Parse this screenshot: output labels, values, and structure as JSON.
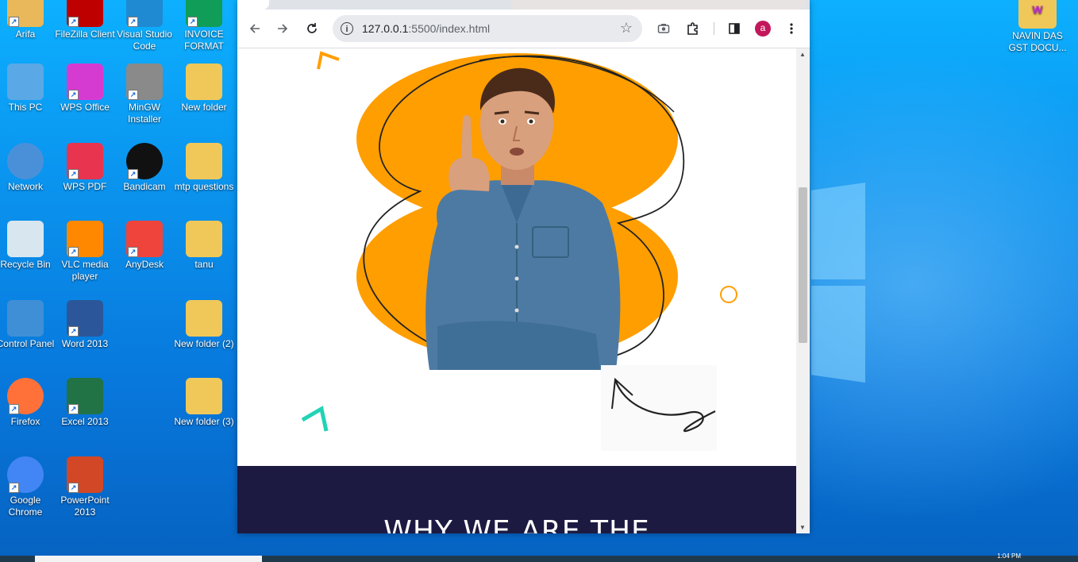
{
  "desktop": {
    "icons_col1": [
      {
        "label": "Arifa",
        "icon": "user-folder-icon",
        "color": "#e8b85a"
      },
      {
        "label": "This PC",
        "icon": "computer-icon",
        "color": "#5aa8e6"
      },
      {
        "label": "Network",
        "icon": "network-icon",
        "color": "#4a90d9"
      },
      {
        "label": "Recycle Bin",
        "icon": "recycle-bin-icon",
        "color": "#d8e6f0"
      },
      {
        "label": "Control Panel",
        "icon": "control-panel-icon",
        "color": "#3f8fd6"
      },
      {
        "label": "Firefox",
        "icon": "firefox-icon",
        "color": "#ff7139"
      },
      {
        "label": "Google Chrome",
        "icon": "chrome-icon",
        "color": "#4285f4"
      }
    ],
    "icons_col2": [
      {
        "label": "FileZilla Client",
        "icon": "filezilla-icon",
        "color": "#bf0000"
      },
      {
        "label": "WPS Office",
        "icon": "wps-office-icon",
        "color": "#d63bd1"
      },
      {
        "label": "WPS PDF",
        "icon": "wps-pdf-icon",
        "color": "#e8344e"
      },
      {
        "label": "VLC media player",
        "icon": "vlc-icon",
        "color": "#ff8800"
      },
      {
        "label": "Word 2013",
        "icon": "word-icon",
        "color": "#2b579a"
      },
      {
        "label": "Excel 2013",
        "icon": "excel-icon",
        "color": "#217346"
      },
      {
        "label": "PowerPoint 2013",
        "icon": "powerpoint-icon",
        "color": "#d24726"
      }
    ],
    "icons_col3": [
      {
        "label": "Visual Studio Code",
        "icon": "vscode-icon",
        "color": "#1f8ad2"
      },
      {
        "label": "MinGW Installer",
        "icon": "mingw-installer-icon",
        "color": "#8a8a8a"
      },
      {
        "label": "Bandicam",
        "icon": "bandicam-icon",
        "color": "#111111"
      },
      {
        "label": "AnyDesk",
        "icon": "anydesk-icon",
        "color": "#ef443b"
      }
    ],
    "icons_col4": [
      {
        "label": "INVOICE FORMAT",
        "icon": "sheets-file-icon",
        "color": "#0f9d58"
      },
      {
        "label": "New folder",
        "icon": "folder-icon",
        "color": "#f0c85a"
      },
      {
        "label": "mtp questions",
        "icon": "folder-icon",
        "color": "#f0c85a"
      },
      {
        "label": "tanu",
        "icon": "folder-icon",
        "color": "#f0c85a"
      },
      {
        "label": "New folder (2)",
        "icon": "folder-icon",
        "color": "#f0c85a"
      },
      {
        "label": "New folder (3)",
        "icon": "folder-icon",
        "color": "#f0c85a"
      }
    ],
    "icon_right": {
      "label": "NAVIN DAS GST DOCU...",
      "icon": "folder-icon",
      "color": "#f0c85a"
    }
  },
  "browser": {
    "url_host": "127.0.0.1",
    "url_rest": ":5500/index.html",
    "avatar_letter": "a",
    "accent_orange": "#ff9e00",
    "dark_navy": "#1d1a42",
    "teal": "#22d3b5"
  },
  "page": {
    "section_heading": "WHY WE ARE THE"
  },
  "taskbar": {
    "clock": "1:04 PM"
  }
}
